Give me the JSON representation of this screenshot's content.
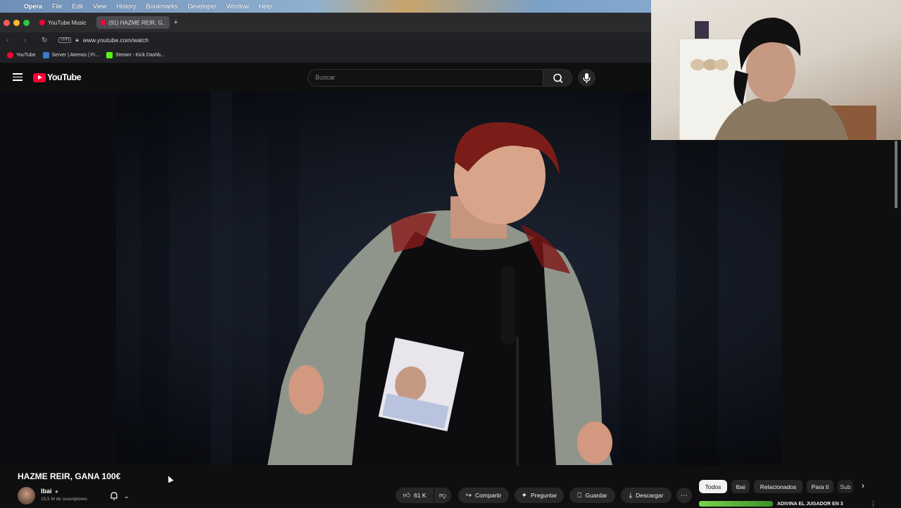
{
  "menubar": {
    "app": "Opera",
    "items": [
      "File",
      "Edit",
      "View",
      "History",
      "Bookmarks",
      "Developer",
      "Window",
      "Help"
    ]
  },
  "browser": {
    "tabs": [
      {
        "label": "YouTube Music"
      },
      {
        "label": "(91) HAZME REIR, G..."
      }
    ],
    "url": "www.youtube.com/watch",
    "vpn_label": "VPN",
    "bookmarks": [
      {
        "label": "YouTube",
        "color": "#ff0033"
      },
      {
        "label": "Server | Atemos | Fr...",
        "color": "#3a7bd5"
      },
      {
        "label": "Stream - Kick Dashb...",
        "color": "#53fc18"
      }
    ]
  },
  "youtube": {
    "logo_text": "YouTube",
    "search_placeholder": "Buscar"
  },
  "video": {
    "title": "HAZME REIR, GANA 100€",
    "channel": "Ibai",
    "subscribers": "15,5 M de suscriptores",
    "likes": "61 K",
    "actions": {
      "share": "Compartir",
      "ask": "Preguntar",
      "save": "Guardar",
      "download": "Descargar"
    }
  },
  "chips": [
    "Todos",
    "Ibai",
    "Relacionados",
    "Para ti",
    "Sub"
  ],
  "next_video_title": "ADIVINA EL JUGADOR EN 3",
  "colors": {
    "brand": "#ff0033",
    "bg": "#0f0f0f",
    "pill": "#272727"
  }
}
